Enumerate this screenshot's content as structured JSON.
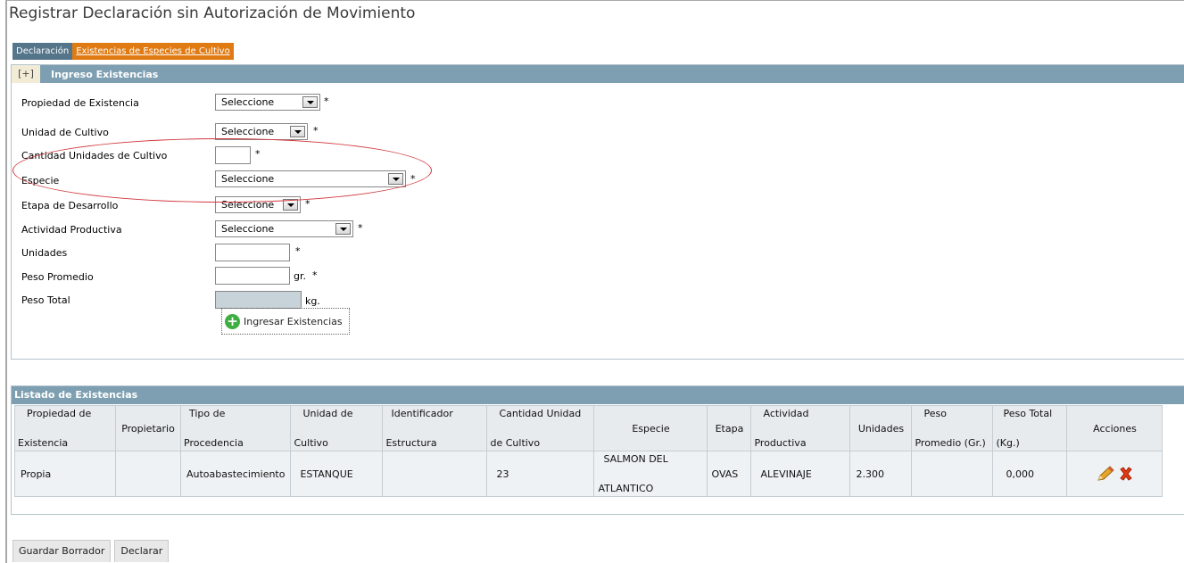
{
  "page": {
    "title": "Registrar Declaración sin Autorización de Movimiento"
  },
  "tabs": [
    {
      "label": "Declaración"
    },
    {
      "label": "Existencias de Especies de Cultivo"
    }
  ],
  "ingreso": {
    "toggle": "[+]",
    "title": "Ingreso Existencias",
    "fields": {
      "propiedad": {
        "label": "Propiedad de Existencia",
        "value": "Seleccione"
      },
      "unidad_cultivo": {
        "label": "Unidad de Cultivo",
        "value": "Seleccione"
      },
      "cantidad": {
        "label": "Cantidad Unidades de Cultivo",
        "value": ""
      },
      "especie": {
        "label": "Especie",
        "value": "Seleccione"
      },
      "etapa": {
        "label": "Etapa de Desarrollo",
        "value": "Seleccione"
      },
      "actividad": {
        "label": "Actividad Productiva",
        "value": "Seleccione"
      },
      "unidades": {
        "label": "Unidades",
        "value": ""
      },
      "peso_promedio": {
        "label": "Peso Promedio",
        "value": "",
        "unit": "gr."
      },
      "peso_total": {
        "label": "Peso Total",
        "value": "",
        "unit": "kg."
      }
    },
    "required_mark": "*",
    "add_button": "Ingresar Existencias"
  },
  "listado": {
    "title": "Listado de Existencias",
    "headers": [
      [
        "Propiedad de",
        "Existencia"
      ],
      [
        "Propietario"
      ],
      [
        "Tipo de",
        "Procedencia"
      ],
      [
        "Unidad de",
        "Cultivo"
      ],
      [
        "Identificador",
        "Estructura"
      ],
      [
        "Cantidad Unidad",
        "de Cultivo"
      ],
      [
        "Especie"
      ],
      [
        "Etapa"
      ],
      [
        "Actividad",
        "Productiva"
      ],
      [
        "Unidades"
      ],
      [
        "Peso",
        "Promedio (Gr.)"
      ],
      [
        "Peso Total",
        "(Kg.)"
      ],
      [
        "Acciones"
      ]
    ],
    "rows": [
      {
        "propiedad": "Propia",
        "propietario": "",
        "procedencia": "Autoabastecimiento",
        "unidad": "ESTANQUE",
        "identificador": "",
        "cantidad": "23",
        "especie_line1": "SALMON DEL",
        "especie_line2": "ATLANTICO",
        "etapa": "OVAS",
        "actividad": "ALEVINAJE",
        "unidades": "2.300",
        "peso_promedio": "",
        "peso_total": "0,000",
        "actions": [
          "pencil-icon",
          "delete-icon"
        ]
      }
    ]
  },
  "footer": {
    "guardar": "Guardar Borrador",
    "declarar": "Declarar"
  }
}
